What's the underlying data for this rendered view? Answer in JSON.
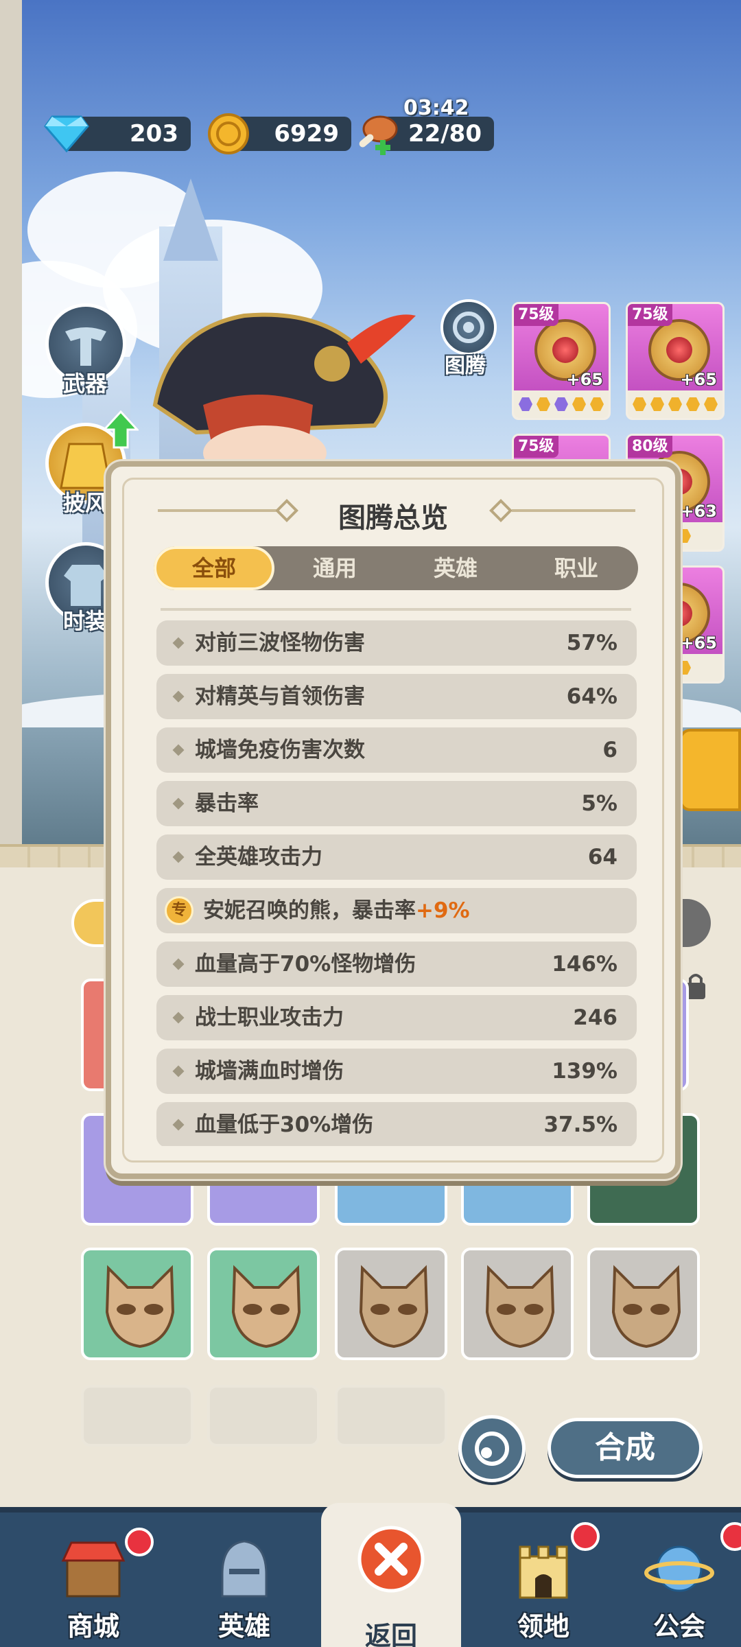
{
  "resources": {
    "diamonds": "203",
    "gold": "6929",
    "stamina": "22/80",
    "timer": "03:42"
  },
  "left_menu": {
    "weapon": "武器",
    "cape": "披风",
    "outfit": "时装"
  },
  "totem_button_label": "图腾",
  "totem_cards": [
    {
      "level": "75级",
      "bonus": "+65"
    },
    {
      "level": "75级",
      "bonus": "+65"
    },
    {
      "level": "75级",
      "bonus": ""
    },
    {
      "level": "80级",
      "bonus": "+63"
    },
    {
      "level": "",
      "bonus": "+65"
    }
  ],
  "dialog": {
    "title": "图腾总览",
    "tabs": [
      "全部",
      "通用",
      "英雄",
      "职业"
    ],
    "active_tab": "全部",
    "stats": [
      {
        "name": "对前三波怪物伤害",
        "value": "57%"
      },
      {
        "name": "对精英与首领伤害",
        "value": "64%"
      },
      {
        "name": "城墙免疫伤害次数",
        "value": "6"
      },
      {
        "name": "暴击率",
        "value": "5%"
      },
      {
        "name": "全英雄攻击力",
        "value": "64"
      },
      {
        "badge": "专",
        "name": "安妮召唤的熊，暴击率",
        "accent": "+9%"
      },
      {
        "name": "血量高于70%怪物增伤",
        "value": "146%"
      },
      {
        "name": "战士职业攻击力",
        "value": "246"
      },
      {
        "name": "城墙满血时增伤",
        "value": "139%"
      },
      {
        "name": "血量低于30%增伤",
        "value": "37.5%"
      }
    ]
  },
  "merge_button": "合成",
  "nav": {
    "shop": "商城",
    "heroes": "英雄",
    "back": "返回",
    "territory": "领地",
    "guild": "公会"
  },
  "colors": {
    "accent_tab": "#f4c04e",
    "special_accent": "#e06a12",
    "nav_bg": "#2e4c6a"
  }
}
